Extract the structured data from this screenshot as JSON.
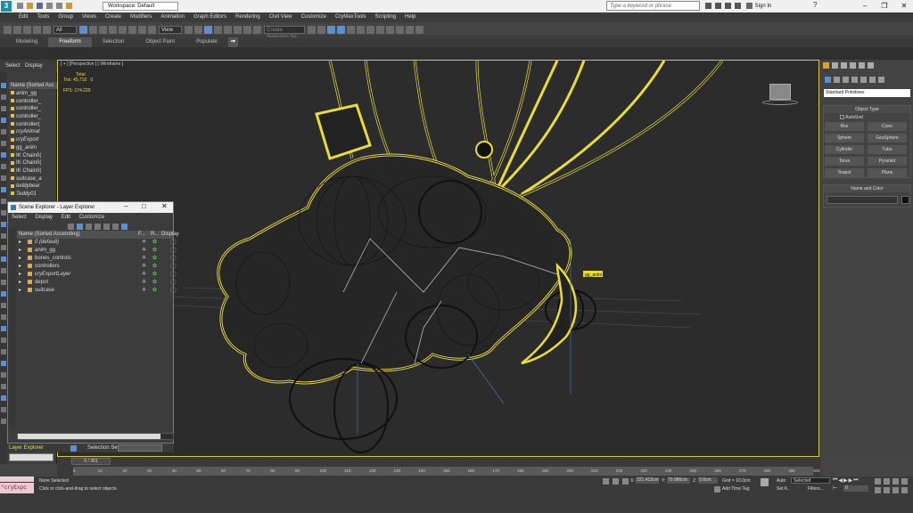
{
  "titlebar": {
    "workspace": "Workspace: Default",
    "search_placeholder": "Type a keyword or phrase",
    "sign_in": "Sign In"
  },
  "menu": [
    "Edit",
    "Tools",
    "Group",
    "Views",
    "Create",
    "Modifiers",
    "Animation",
    "Graph Editors",
    "Rendering",
    "Civil View",
    "Customize",
    "CryMaxTools",
    "Scripting",
    "Help"
  ],
  "toolbar": {
    "filter": "All",
    "view": "View",
    "selset": "Create Selection Se"
  },
  "ribbon": {
    "tabs": [
      "Modeling",
      "Freeform",
      "Selection",
      "Object Paint",
      "Populate"
    ],
    "active": "Freeform"
  },
  "scene_top": {
    "select": "Select",
    "display": "Display"
  },
  "outliner": {
    "header": "Name (Sorted Asc",
    "items": [
      "anim_gg",
      "controller_",
      "controller_",
      "controller_",
      "controller(",
      "cryAnimat",
      "cryExport",
      "gg_anim",
      "IK Chain0(",
      "IK Chain0(",
      "IK Chain0(",
      "suitcase_a",
      "teddybear",
      "Teddy01"
    ]
  },
  "viewport": {
    "label": "[ + ] [Perspective ] [ Wireframe ]",
    "stats_total": "Total",
    "stats_tris_label": "Tris:",
    "stats_tris": "45,710",
    "stats_tris_sel": "0",
    "fps_label": "FPS:",
    "fps": "174.229",
    "tag": "gg_anim"
  },
  "layer_explorer": {
    "title": "Scene Explorer - Layer Explorer",
    "menu": [
      "Select",
      "Display",
      "Edit",
      "Customize"
    ],
    "col_name": "Name (Sorted Ascending)",
    "col_f": "F...",
    "col_r": "R...",
    "col_display": "Display",
    "rows": [
      "0 (default)",
      "anim_gg",
      "bones_controls",
      "controllers",
      "cryExportLayer",
      "depot",
      "suitcase"
    ],
    "footer_label": "Layer Explorer",
    "selset_label": "Selection Set:"
  },
  "cmd": {
    "dropdown": "Standard Primitives",
    "rollout": "Object Type",
    "autogrid": "AutoGrid",
    "buttons": [
      "Box",
      "Cone",
      "Sphere",
      "GeoSphere",
      "Cylinder",
      "Tube",
      "Torus",
      "Pyramid",
      "Teapot",
      "Plane"
    ],
    "name_color": "Name and Color"
  },
  "timeline": {
    "frame": "0 / 301",
    "ticks": [
      "0",
      "10",
      "20",
      "30",
      "40",
      "50",
      "60",
      "70",
      "80",
      "90",
      "100",
      "110",
      "120",
      "130",
      "140",
      "150",
      "160",
      "170",
      "180",
      "190",
      "200",
      "210",
      "220",
      "230",
      "240",
      "250",
      "260",
      "270",
      "280",
      "290",
      "300"
    ]
  },
  "status": {
    "script": "*cryExpc",
    "selected": "None Selected",
    "hint": "Click or click-and-drag to select objects",
    "x": "221.413cm",
    "y": "79.986cm",
    "z": "0.0cm",
    "grid": "Grid = 10.0cm",
    "add_time_tag": "Add Time Tag",
    "auto": "Auto",
    "selected_btn": "Selected",
    "setk": "Set K.",
    "filters": "Filters...",
    "frame_field": "0"
  },
  "colors": {
    "accent": "#5a8fd0",
    "selection": "#e8dc3a",
    "viewport_bg": "#2c2c2c"
  }
}
